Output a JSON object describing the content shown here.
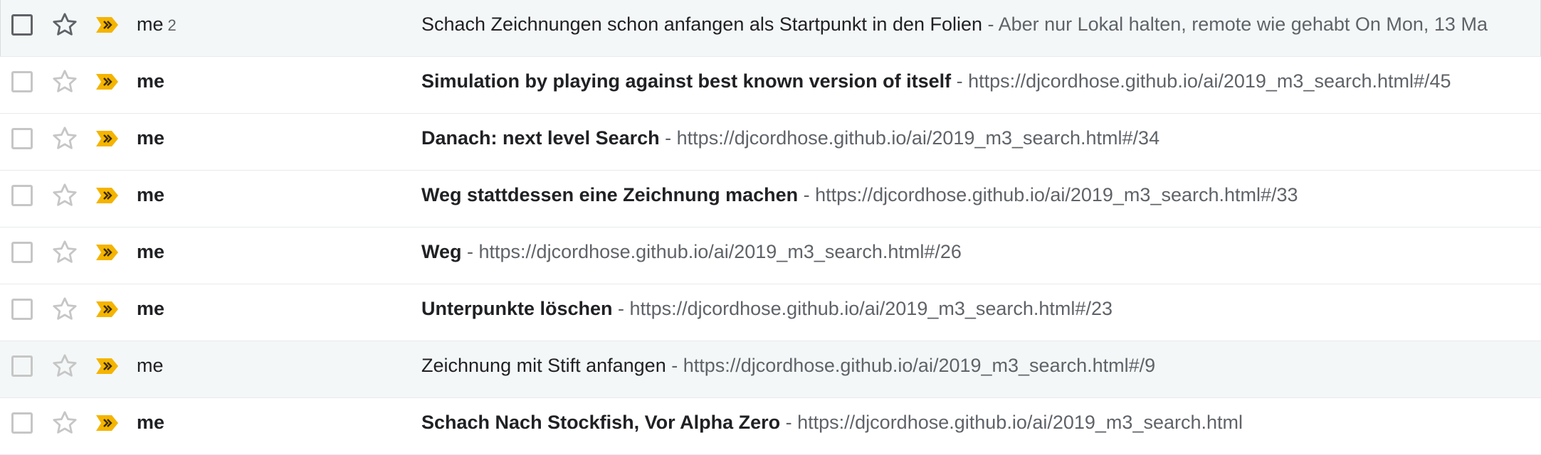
{
  "colors": {
    "important_marker": "#f4b400",
    "star_outline": "#c6c6c6",
    "star_outline_hover": "#5f6368",
    "row_divider": "#e8eaed",
    "read_row_bg": "#f4f7f7"
  },
  "icons": {
    "checkbox": "checkbox-icon",
    "star": "star-outline-icon",
    "important": "important-marker-icon"
  },
  "separator": " - ",
  "emails": [
    {
      "sender": "me",
      "count": "2",
      "subject": "Schach Zeichnungen schon anfangen als Startpunkt in den Folien",
      "snippet": "Aber nur Lokal halten, remote wie gehabt On Mon, 13 Ma",
      "unread": false
    },
    {
      "sender": "me",
      "count": "",
      "subject": "Simulation by playing against best known version of itself",
      "snippet": "https://djcordhose.github.io/ai/2019_m3_search.html#/45",
      "unread": true
    },
    {
      "sender": "me",
      "count": "",
      "subject": "Danach: next level Search",
      "snippet": "https://djcordhose.github.io/ai/2019_m3_search.html#/34",
      "unread": true
    },
    {
      "sender": "me",
      "count": "",
      "subject": "Weg stattdessen eine Zeichnung machen",
      "snippet": "https://djcordhose.github.io/ai/2019_m3_search.html#/33",
      "unread": true
    },
    {
      "sender": "me",
      "count": "",
      "subject": "Weg",
      "snippet": "https://djcordhose.github.io/ai/2019_m3_search.html#/26",
      "unread": true
    },
    {
      "sender": "me",
      "count": "",
      "subject": "Unterpunkte löschen",
      "snippet": "https://djcordhose.github.io/ai/2019_m3_search.html#/23",
      "unread": true
    },
    {
      "sender": "me",
      "count": "",
      "subject": "Zeichnung mit Stift anfangen",
      "snippet": "https://djcordhose.github.io/ai/2019_m3_search.html#/9",
      "unread": false
    },
    {
      "sender": "me",
      "count": "",
      "subject": "Schach Nach Stockfish, Vor Alpha Zero",
      "snippet": "https://djcordhose.github.io/ai/2019_m3_search.html",
      "unread": true
    }
  ]
}
